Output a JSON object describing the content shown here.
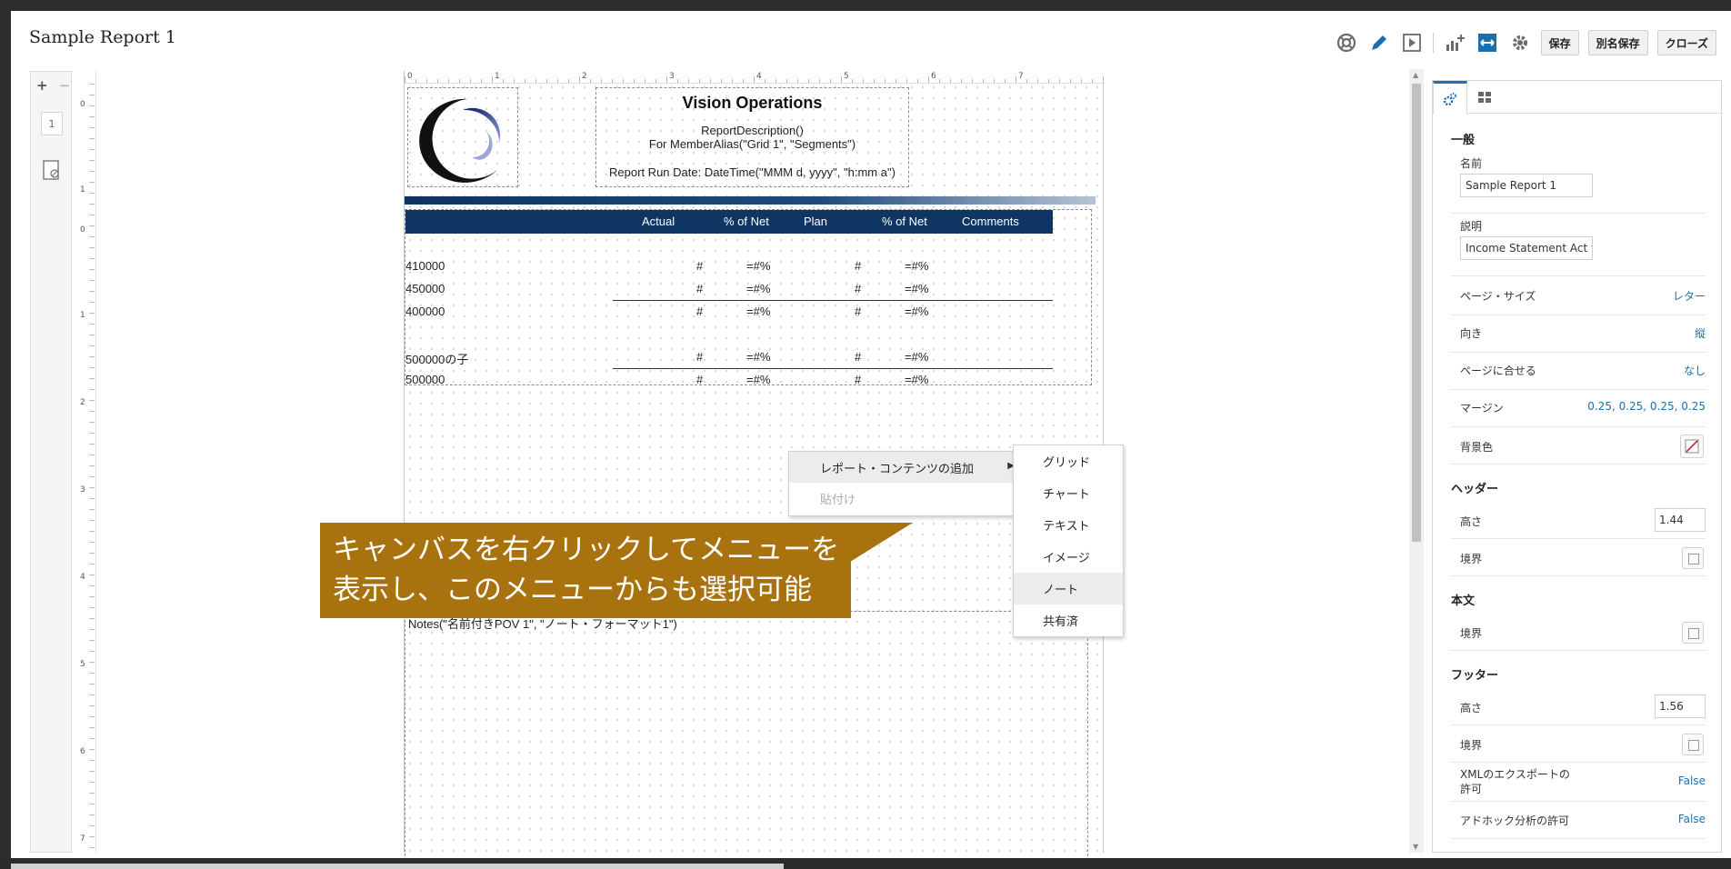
{
  "window": {
    "title": "Sample Report 1"
  },
  "toolbar": {
    "icons": [
      "help-icon",
      "pencil-icon",
      "play-icon",
      "chart-add-icon",
      "fit-width-icon",
      "gear-icon"
    ],
    "save": "保存",
    "save_as": "別名保存",
    "close": "クローズ"
  },
  "left_strip": {
    "page_number": "1",
    "add": "+",
    "remove": "−"
  },
  "vertical_ruler": [
    "0",
    "1",
    "0",
    "1",
    "2",
    "3",
    "4",
    "5",
    "6",
    "7"
  ],
  "horizontal_ruler": [
    "0",
    "1",
    "2",
    "3",
    "4",
    "5",
    "6",
    "7"
  ],
  "header": {
    "title": "Vision Operations",
    "description": "ReportDescription()",
    "alias": "For MemberAlias(\"Grid 1\", \"Segments\")",
    "run_date": "Report Run Date: DateTime(\"MMM d, yyyy\", \"h:mm a\")"
  },
  "grid": {
    "columns": [
      "Actual",
      "% of Net",
      "Plan",
      "% of Net",
      "Comments"
    ],
    "rows": [
      {
        "label": "410000",
        "c1": "#",
        "c2": "=#%",
        "c3": "#",
        "c4": "=#%"
      },
      {
        "label": "450000",
        "c1": "#",
        "c2": "=#%",
        "c3": "#",
        "c4": "=#%"
      },
      {
        "label": "400000",
        "c1": "#",
        "c2": "=#%",
        "c3": "#",
        "c4": "=#%"
      },
      {
        "label": "500000の子",
        "c1": "#",
        "c2": "=#%",
        "c3": "#",
        "c4": "=#%"
      },
      {
        "label": "500000",
        "c1": "#",
        "c2": "=#%",
        "c3": "#",
        "c4": "=#%"
      }
    ]
  },
  "notes": {
    "text": "Notes(\"名前付きPOV 1\", \"ノート・フォーマット1\")"
  },
  "context_menu": {
    "add_content": "レポート・コンテンツの追加",
    "paste": "貼付け",
    "submenu": [
      "グリッド",
      "チャート",
      "テキスト",
      "イメージ",
      "ノート",
      "共有済"
    ],
    "highlighted": "ノート"
  },
  "callout": {
    "text": "キャンバスを右クリックしてメニューを\n表示し、このメニューからも選択可能",
    "color": "#a8730e"
  },
  "properties": {
    "sections": {
      "general": "一般",
      "header": "ヘッダー",
      "body": "本文",
      "footer": "フッター"
    },
    "name_label": "名前",
    "name_value": "Sample Report 1",
    "desc_label": "説明",
    "desc_value": "Income Statement Act vs",
    "page_size_label": "ページ・サイズ",
    "page_size_value": "レター",
    "orientation_label": "向き",
    "orientation_value": "縦",
    "fit_label": "ページに合せる",
    "fit_value": "なし",
    "margin_label": "マージン",
    "margin_value": "0.25, 0.25, 0.25, 0.25",
    "bg_label": "背景色",
    "header_height_label": "高さ",
    "header_height_value": "1.44",
    "header_border_label": "境界",
    "body_border_label": "境界",
    "footer_height_label": "高さ",
    "footer_height_value": "1.56",
    "footer_border_label": "境界",
    "xml_label": "XMLのエクスポートの許可",
    "xml_value": "False",
    "adhoc_label": "アドホック分析の許可",
    "adhoc_value": "False"
  },
  "colors": {
    "accent": "#1a6fb0",
    "grid_header": "#0f3563"
  }
}
